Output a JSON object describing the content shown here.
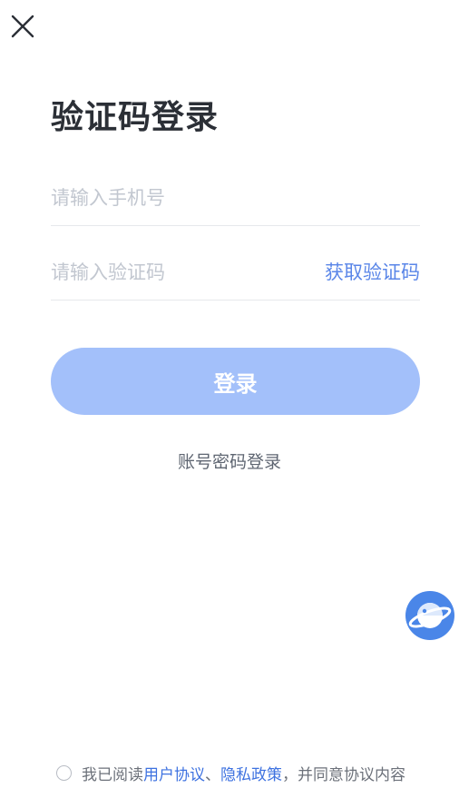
{
  "header": {
    "close_icon": "close-icon",
    "title": "验证码登录"
  },
  "form": {
    "phone_placeholder": "请输入手机号",
    "phone_value": "",
    "code_placeholder": "请输入验证码",
    "code_value": "",
    "get_code_label": "获取验证码",
    "login_label": "登录",
    "alt_login_label": "账号密码登录"
  },
  "floating_button": {
    "icon": "planet-icon"
  },
  "agreement": {
    "checked": false,
    "prefix": "我已阅读",
    "user_agreement": "用户协议",
    "separator": "、",
    "privacy_policy": "隐私政策",
    "suffix": "，并同意协议内容"
  },
  "colors": {
    "primary": "#5a86e8",
    "button_disabled": "#a3c0fa",
    "link": "#3e72e0",
    "title": "#2b2f36",
    "placeholder": "#c2c7d0"
  }
}
